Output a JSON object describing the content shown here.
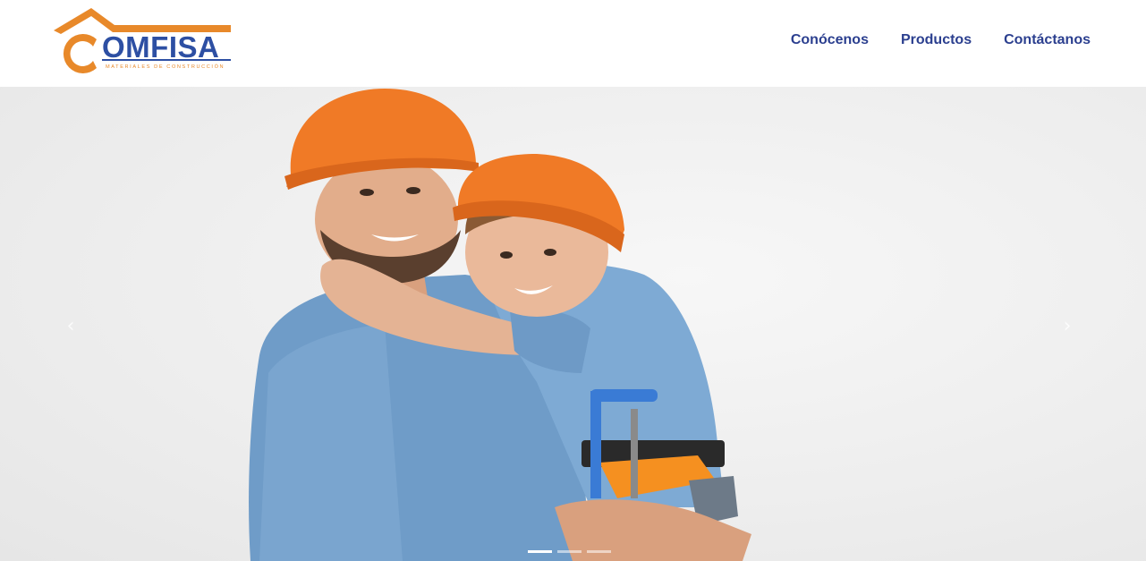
{
  "brand": {
    "name": "OMFISA",
    "initial": "C",
    "tagline": "MATERIALES DE CONSTRUCCIÓN",
    "colors": {
      "orange": "#e8892a",
      "blue": "#2d4fa3"
    }
  },
  "nav": {
    "items": [
      {
        "label": "Conócenos"
      },
      {
        "label": "Productos"
      },
      {
        "label": "Contáctanos"
      }
    ],
    "color": "#2b3f8f"
  },
  "hero": {
    "image": "father-and-son-with-hard-hats",
    "prev_icon": "chevron-left-icon",
    "next_icon": "chevron-right-icon",
    "prev_glyph": "‹",
    "next_glyph": "›",
    "slides_total": 3,
    "active_slide": 1
  }
}
